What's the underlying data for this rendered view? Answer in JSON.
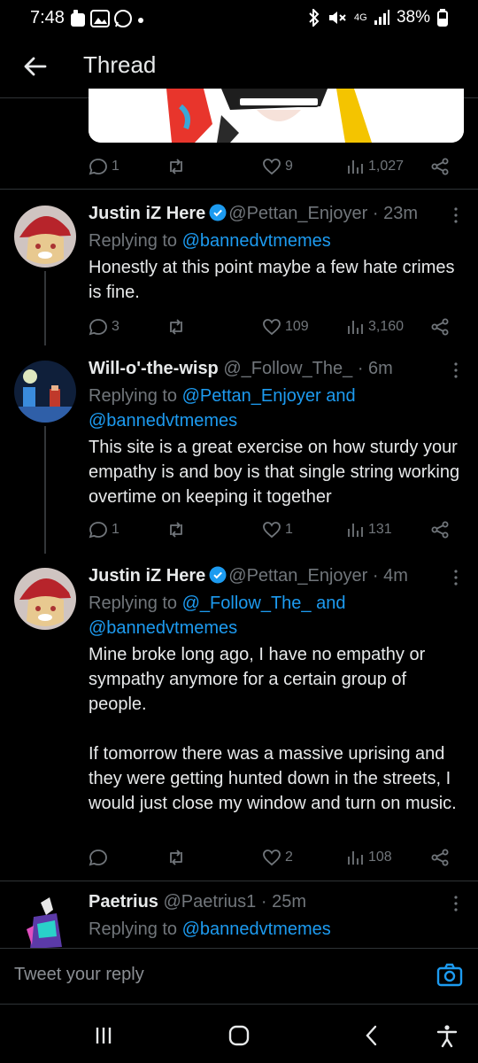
{
  "status_bar": {
    "time": "7:48",
    "network": "4G",
    "battery": "38%"
  },
  "header": {
    "title": "Thread"
  },
  "top_actions": {
    "replies": "1",
    "likes": "9",
    "views": "1,027"
  },
  "tweets": [
    {
      "name": "Justin iZ Here",
      "handle": "@Pettan_Enjoyer",
      "time": "· 23m",
      "replying_prefix": "Replying to ",
      "replying_to": "@bannedvtmemes",
      "replying_to_2": "",
      "text": "Honestly at this point maybe a few hate crimes is fine.",
      "replies": "3",
      "retweets": "",
      "likes": "109",
      "views": "3,160"
    },
    {
      "name": "Will-o'-the-wisp",
      "handle": "@_Follow_The_",
      "time": "· 6m",
      "replying_prefix": "Replying to ",
      "replying_to": "@Pettan_Enjoyer and",
      "replying_to_2": "@bannedvtmemes",
      "text": "This site is a great exercise on how sturdy your empathy is and boy is that single string working overtime on keeping it together",
      "replies": "1",
      "retweets": "",
      "likes": "1",
      "views": "131"
    },
    {
      "name": "Justin iZ Here",
      "handle": "@Pettan_Enjoyer",
      "time": "· 4m",
      "replying_prefix": "Replying to ",
      "replying_to": "@_Follow_The_ and",
      "replying_to_2": "@bannedvtmemes",
      "text": "Mine broke long ago, I have no empathy or sympathy anymore for a certain group of people.\n\nIf tomorrow there was a massive uprising and they were getting hunted down in the streets, I would just close my window and turn on music.",
      "replies": "",
      "retweets": "",
      "likes": "2",
      "views": "108"
    },
    {
      "name": "Paetrius",
      "handle": "@Paetrius1",
      "time": "· 25m",
      "replying_prefix": "Replying to ",
      "replying_to": "@bannedvtmemes"
    }
  ],
  "reply_box": {
    "placeholder": "Tweet your reply"
  },
  "colors": {
    "accent": "#1d9bf0",
    "muted": "#71767b",
    "background": "#000000",
    "verified": "#1d9bf0"
  }
}
